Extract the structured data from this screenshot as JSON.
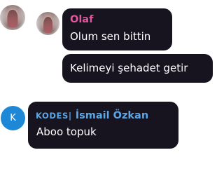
{
  "colors": {
    "bubble": "#17131f",
    "text": "#ffffff",
    "author_olaf": "#e0569c",
    "author_kodes": "#5aa7e8",
    "avatar_kodes": "#1e88d6"
  },
  "messages": [
    {
      "author": "Olaf",
      "avatar": "photo",
      "lines": [
        "Olum sen bittin",
        "Kelimeyi şehadet getir"
      ]
    },
    {
      "author_prefix": "KODES|",
      "author_name": "İsmail Özkan",
      "avatar_initial": "K",
      "lines": [
        "Aboo topuk"
      ]
    }
  ]
}
